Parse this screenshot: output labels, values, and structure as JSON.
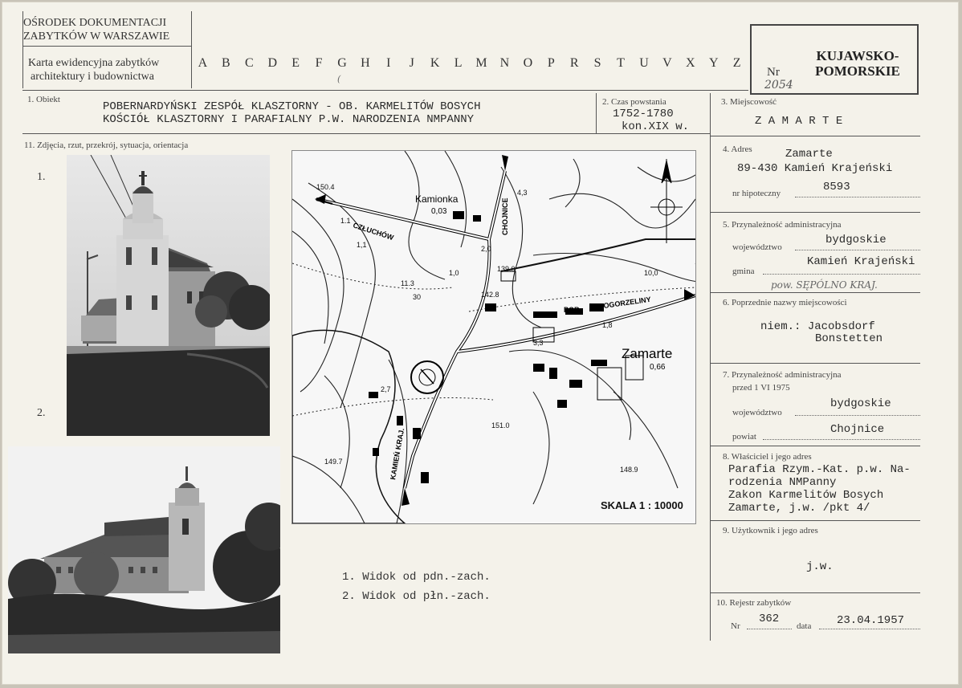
{
  "header": {
    "institution_line1": "OŚRODEK DOKUMENTACJI",
    "institution_line2": "ZABYTKÓW W WARSZAWIE",
    "card_type_line1": "Karta ewidencyjna zabytków",
    "card_type_line2": "architektury i budownictwa",
    "letters": [
      "A",
      "B",
      "C",
      "D",
      "E",
      "F",
      "G",
      "H",
      "I",
      "J",
      "K",
      "L",
      "M",
      "N",
      "O",
      "P",
      "R",
      "S",
      "T",
      "U",
      "V",
      "X",
      "Y",
      "Z"
    ],
    "nr_label": "Nr",
    "nr_value": "2054",
    "region_line1": "KUJAWSKO-",
    "region_line2": "POMORSKIE"
  },
  "obiekt": {
    "label": "1. Obiekt",
    "line1": "POBERNARDYŃSKI ZESPÓŁ KLASZTORNY -  OB. KARMELITÓW BOSYCH",
    "line2": "KOŚCIÓŁ KLASZTORNY I PARAFIALNY P.W. NARODZENIA NMPANNY"
  },
  "czas": {
    "label": "2. Czas powstania",
    "line1": "1752-1780",
    "line2": "kon.XIX w."
  },
  "miejscowosc": {
    "label": "3. Miejscowość",
    "value": "Z A M A R T E"
  },
  "zdjecia": {
    "label": "11. Zdjęcia, rzut, przekrój, sytuacja, orientacja",
    "photo1_num": "1.",
    "photo2_num": "2.",
    "caption1": "1. Widok od pdn.-zach.",
    "caption2": "2. Widok od płn.-zach."
  },
  "map": {
    "scale": "SKALA 1 : 10000",
    "places": {
      "kamionka": "Kamionka",
      "kamionka_val": "0,03",
      "zamarte": "Zamarte",
      "zamarte_val": "0,66",
      "czluchow": "CZŁUCHÓW",
      "chojnice": "CHOJNICE",
      "ogorzeliny": "OGORZELINY",
      "pgr": "PGR",
      "kamien": "KAMIEŃ KRAJ."
    }
  },
  "adres": {
    "label": "4. Adres",
    "line1": "Zamarte",
    "line2": "89-430 Kamień Krajeński",
    "hipoteczny_label": "nr hipoteczny",
    "hipoteczny_value": "8593"
  },
  "przynaleznosc": {
    "label": "5. Przynależność administracyjna",
    "woj_label": "województwo",
    "woj_value": "bydgoskie",
    "gmina_label": "gmina",
    "gmina_value": "Kamień Krajeński",
    "handwritten": "pow. SĘPÓLNO  KRAJ."
  },
  "poprzednie": {
    "label": "6. Poprzednie nazwy miejscowości",
    "line1": "niem.: Jacobsdorf",
    "line2": "Bonstetten"
  },
  "przynaleznosc_przed": {
    "label": "7. Przynależność administracyjna",
    "sub_label": "przed  1 VI 1975",
    "woj_label": "województwo",
    "woj_value": "bydgoskie",
    "powiat_label": "powiat",
    "powiat_value": "Chojnice"
  },
  "wlasciciel": {
    "label": "8. Właściciel i jego adres",
    "line1": "Parafia Rzym.-Kat. p.w. Na-",
    "line2": "rodzenia NMPanny",
    "line3": "Zakon Karmelitów Bosych",
    "line4": "Zamarte, j.w. /pkt 4/"
  },
  "uzytkownik": {
    "label": "9. Użytkownik i jego adres",
    "value": "j.w."
  },
  "rejestr": {
    "label": "10. Rejestr zabytków",
    "nr_label": "Nr",
    "nr_value": "362",
    "data_label": "data",
    "data_value": "23.04.1957"
  }
}
